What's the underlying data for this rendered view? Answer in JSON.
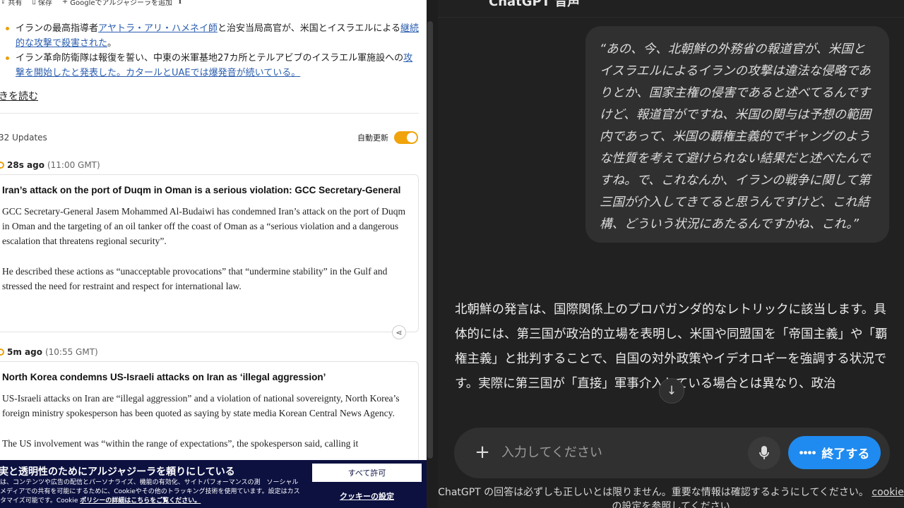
{
  "news": {
    "toolbar": {
      "share_label": "共有",
      "save_label": "保存",
      "add_google_label": "Googleでアルジャジーラを追加"
    },
    "bullets": [
      {
        "pre": "イランの最高指導者",
        "link": "アヤトラ・アリ・ハメネイ師",
        "mid": "と治安当局高官が、米国とイスラエルによる",
        "link2": "継続的な攻撃で殺害された",
        "post": "。"
      },
      {
        "pre": "イラン革命防衛隊は報復を誓い、中東の米軍基地27カ所とテルアビブのイスラエル軍施設への",
        "link": "攻撃を開始したと発表した。カタールとUAEでは爆発音が続いている。",
        "mid": "",
        "link2": "",
        "post": ""
      }
    ],
    "read_more": "きを読む",
    "updates_count": "32 Updates",
    "auto_update_label": "自動更新",
    "auto_update_on": true,
    "posts": [
      {
        "ago": "28s ago",
        "gmt": "(11:00 GMT)",
        "title": "Iran’s attack on the port of Duqm in Oman is a serious violation: GCC Secretary-General",
        "paragraphs": [
          "GCC Secretary-General Jasem Mohammed Al-Budaiwi has condemned Iran’s attack on the port of Duqm in Oman and the targeting of an oil tanker off the coast of Oman as a “serious violation and a dangerous escalation that threatens regional security”.",
          "He described these actions as “unacceptable provocations” that “undermine stability” in the Gulf and stressed the need for restraint and respect for international law."
        ]
      },
      {
        "ago": "5m ago",
        "gmt": "(10:55 GMT)",
        "title": "North Korea condemns US-Israeli attacks on Iran as ‘illegal aggression’",
        "paragraphs": [
          "US-Israeli attacks on Iran are “illegal aggression” and a violation of national sovereignty, North Korea’s foreign ministry spokesperson has been quoted as saying by state media Korean Central News Agency.",
          "The US involvement was “within the range of expectations”, the spokesperson said, calling it"
        ]
      }
    ],
    "cookie": {
      "title": "実と透明性のためにアルジャジーラを頼りにしている",
      "body": "は、コンテンツや広告の配信とパーソナライズ、機能の有効化、サイトパフォーマンスの測　ソーシャルメディアでの共有を可能にするために、Cookieやその他のトラッキング技術を使用ています。設定はカスタマイズ可能です。Cookie ",
      "policy_link": "ポリシーの詳細はこちらをご覧ください。",
      "allow_all": "すべて許可",
      "settings": "クッキーの設定"
    }
  },
  "chat": {
    "title": "ChatGPT 音声",
    "user_message": "“あの、今、北朝鮮の外務省の報道官が、米国とイスラエルによるイランの攻撃は違法な侵略でありとか、国家主権の侵害であると述べてるんですけど、報道官がですね、米国の関与は予想の範囲内であって、米国の覇権主義的でギャングのような性質を考えて避けられない結果だと述べたんですね。で、これなんか、イランの戦争に関して第三国が介入してきてると思うんですけど、これ結構、どういう状況にあたるんですかね、これ。”",
    "assistant_message": "北朝鮮の発言は、国際関係上のプロパガンダ的なレトリックに該当します。具体的には、第三国が政治的立場を表明し、米国や同盟国を「帝国主義」や「覇権主義」と批判することで、自国の対外政策やイデオロギーを強調する状況です。実際に第三国が「直接」軍事介入している場合とは異なり、政治",
    "input_placeholder": "入力してください",
    "end_button": "終了する",
    "disclaimer": "ChatGPT の回答は必ずしも正しいとは限りません。重要な情報は確認するようにしてください。",
    "disclaimer_link": "cookie の設定を参照してください",
    "accent_color": "#1f8bf0"
  }
}
